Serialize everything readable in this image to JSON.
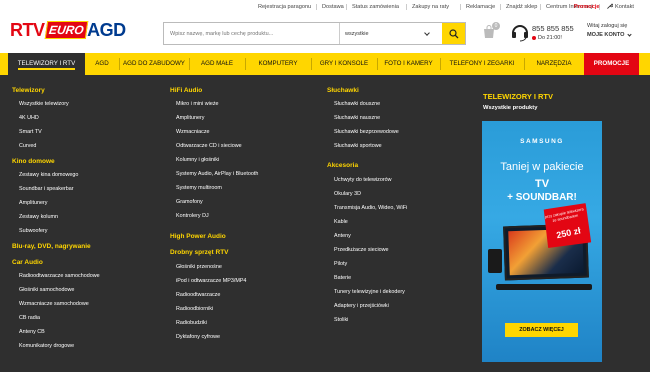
{
  "toplinks": {
    "items": [
      "Rejestracja paragonu",
      "Dostawa",
      "Status zamówienia",
      "Zakupy na raty",
      "Reklamacje",
      "Znajdź sklep",
      "Centrum Informacji"
    ],
    "promo": "Promocje",
    "kontakt": "Kontakt"
  },
  "logo": {
    "rtv": "RTV",
    "euro": "EURO",
    "agd": "AGD"
  },
  "search": {
    "placeholder": "Wpisz nazwę, markę lub cechę produktu...",
    "category": "wszystkie"
  },
  "cart": {
    "count": "0"
  },
  "phone": {
    "number": "855 855 855",
    "hours": "Do 21:00!"
  },
  "account": {
    "greeting": "Witaj zaloguj się",
    "label": "MOJE KONTO"
  },
  "nav": {
    "items": [
      "TELEWIZORY I RTV",
      "AGD",
      "AGD DO ZABUDOWY",
      "AGD MAŁE",
      "KOMPUTERY",
      "GRY I KONSOLE",
      "FOTO I KAMERY",
      "TELEFONY I ZEGARKI",
      "NARZĘDZIA"
    ],
    "promo": "PROMOCJE"
  },
  "menu": {
    "col1": {
      "h1": "Telewizory",
      "i1": [
        "Wszystkie telewizory",
        "4K UHD",
        "Smart TV",
        "Curved"
      ],
      "h2": "Kino domowe",
      "i2": [
        "Zestawy kina domowego",
        "Soundbar i speakerbar",
        "Amplitunery",
        "Zestawy kolumn",
        "Subwoofery"
      ],
      "h3": "Blu-ray, DVD, nagrywanie",
      "h4": "Car Audio",
      "i4": [
        "Radioodtwarzacze samochodowe",
        "Głośniki samochodowe",
        "Wzmacniacze samochodowe",
        "CB radia",
        "Anteny CB",
        "Komunikatory drogowe"
      ]
    },
    "col2": {
      "h1": "HiFi Audio",
      "i1": [
        "Mikro i mini wieże",
        "Amplitunery",
        "Wzmacniacze",
        "Odtwarzacze CD i sieciowe",
        "Kolumny i głośniki",
        "Systemy Audio, AirPlay i Bluetooth",
        "Systemy multiroom",
        "Gramofony",
        "Kontrolery DJ"
      ],
      "h2": "High Power Audio",
      "h3": "Drobny sprzęt RTV",
      "i3": [
        "Głośniki przenośne",
        "iPod i odtwarzacze MP3/MP4",
        "Radioodtwarzacze",
        "Radioodbiorniki",
        "Radiobudziki",
        "Dyktafony cyfrowe"
      ]
    },
    "col3": {
      "h1": "Słuchawki",
      "i1": [
        "Słuchawki douszne",
        "Słuchawki nauszne",
        "Słuchawki bezprzewodowe",
        "Słuchawki sportowe"
      ],
      "h2": "Akcesoria",
      "i2": [
        "Uchwyty do telewizorów",
        "Okulary 3D",
        "Transmisja Audio, Wideo, WiFi",
        "Kable",
        "Anteny",
        "Przedłużacze sieciowe",
        "Piloty",
        "Baterie",
        "Tunery telewizyjne i dekodery",
        "Adaptery i przejściówki",
        "Stoliki"
      ]
    },
    "promo_title": "TELEWIZORY I RTV",
    "promo_sub": "Wszystkie produkty"
  },
  "banner": {
    "brand": "SAMSUNG",
    "line1": "Taniej w pakiecie",
    "line2": "TV",
    "line3": "+ SOUNDBAR!",
    "burst_small": "przy zakupie telewizora ze soundbarem",
    "burst_price": "250 zł",
    "cta": "ZOBACZ WIĘCEJ"
  },
  "colors": {
    "accent": "#ffd600",
    "brand_red": "#e30613",
    "brand_blue": "#003b8f",
    "menu_bg": "#2f2f2f"
  }
}
